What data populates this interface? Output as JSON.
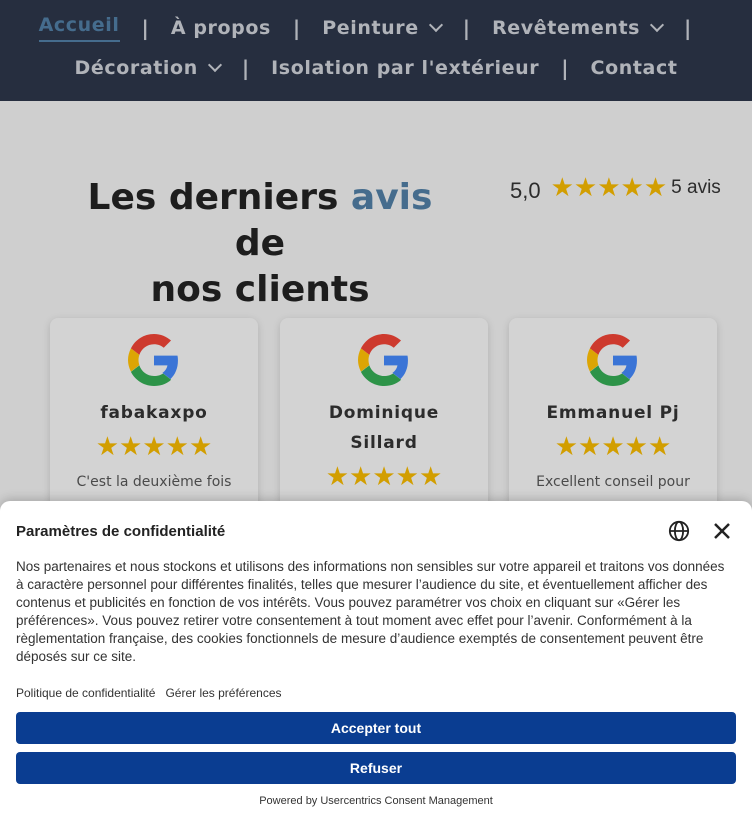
{
  "nav": {
    "row1": [
      {
        "label": "Accueil",
        "active": true,
        "dropdown": false
      },
      {
        "label": "À propos",
        "active": false,
        "dropdown": false
      },
      {
        "label": "Peinture",
        "active": false,
        "dropdown": true
      },
      {
        "label": "Revêtements",
        "active": false,
        "dropdown": true
      }
    ],
    "row2": [
      {
        "label": "Décoration",
        "dropdown": true
      },
      {
        "label": "Isolation par l'extérieur",
        "dropdown": false
      },
      {
        "label": "Contact",
        "dropdown": false
      }
    ],
    "separator": "|"
  },
  "reviews_section": {
    "headline_part1": "Les derniers ",
    "headline_accent": "avis",
    "headline_part2": " de",
    "headline_line2": "nos clients",
    "rating_score": "5,0",
    "rating_count": "5 avis",
    "rating_stars": 5
  },
  "cards": [
    {
      "name_line1": "fabakaxpo",
      "name_line2": "",
      "stars": 5,
      "text": "C'est la deuxième fois"
    },
    {
      "name_line1": "Dominique",
      "name_line2": "Sillard",
      "stars": 5,
      "text": ""
    },
    {
      "name_line1": "Emmanuel Pj",
      "name_line2": "",
      "stars": 5,
      "text": "Excellent conseil pour"
    }
  ],
  "consent": {
    "title": "Paramètres de confidentialité",
    "body": "Nos partenaires et nous stockons et utilisons des informations non sensibles sur votre appareil et traitons vos données à caractère personnel pour différentes finalités, telles que mesurer l’audience du site, et éventuellement afficher des contenus et publicités en fonction de vos intérêts. Vous pouvez paramétrer vos choix en cliquant sur «Gérer les préférences». Vous pouvez retirer votre consentement à tout moment avec effet pour l’avenir. Conformément à la règlementation française, des cookies fonctionnels de mesure d’audience exemptés de consentement peuvent être déposés sur ce site.",
    "link_privacy": "Politique de confidentialité",
    "link_manage": "Gérer les préférences",
    "accept_label": "Accepter tout",
    "refuse_label": "Refuser",
    "powered": "Powered by Usercentrics Consent Management"
  },
  "colors": {
    "nav_bg": "#2c3548",
    "accent": "#4f7ca1",
    "star": "#f0b400",
    "button": "#0a3d91"
  }
}
